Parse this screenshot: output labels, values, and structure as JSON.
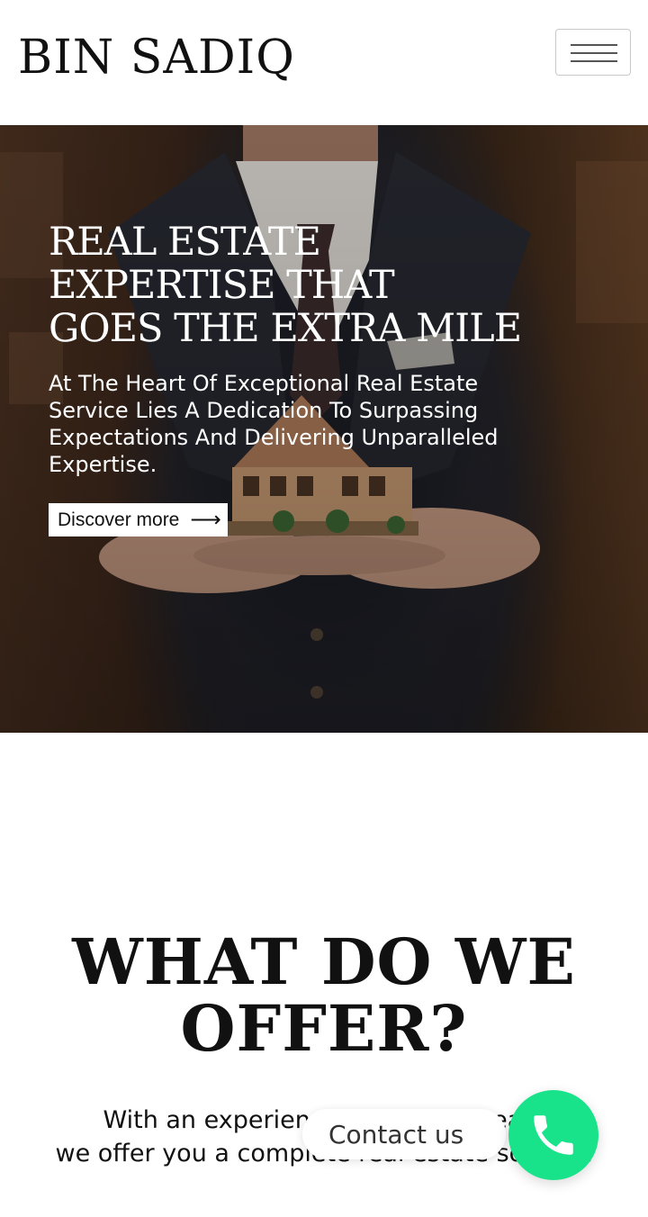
{
  "header": {
    "logo_text": "BIN SADIQ",
    "menu_icon": "hamburger-menu-icon"
  },
  "hero": {
    "title_lines": [
      "REAL ESTATE",
      "EXPERTISE THAT",
      "GOES THE EXTRA MILE"
    ],
    "subtitle_lines": [
      "At The Heart Of Exceptional Real Estate",
      "Service Lies A Dedication To Surpassing",
      "Expectations And Delivering Unparalleled",
      "Expertise."
    ],
    "cta_label": "Discover more",
    "cta_icon": "arrow-right-icon"
  },
  "offer": {
    "title_lines": [
      "WHAT DO WE",
      "OFFER?"
    ],
    "text_lines": [
      "With an experience of over 10 years",
      "we offer you a complete real estate solution"
    ]
  },
  "contact": {
    "label": "Contact us",
    "icon": "phone-icon",
    "accent": "#18e38a"
  }
}
